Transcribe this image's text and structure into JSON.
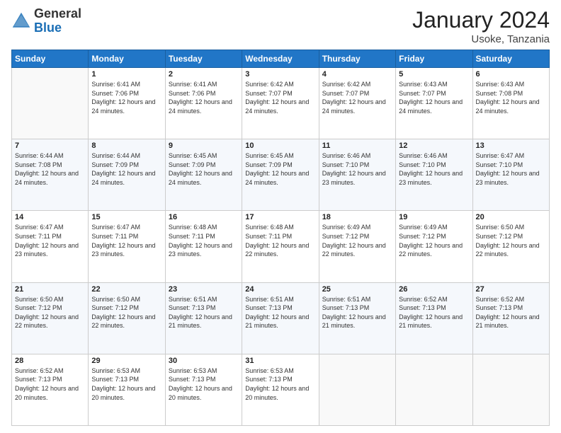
{
  "header": {
    "logo_general": "General",
    "logo_blue": "Blue",
    "month_title": "January 2024",
    "location": "Usoke, Tanzania"
  },
  "days_of_week": [
    "Sunday",
    "Monday",
    "Tuesday",
    "Wednesday",
    "Thursday",
    "Friday",
    "Saturday"
  ],
  "weeks": [
    [
      {
        "day": "",
        "sunrise": "",
        "sunset": "",
        "daylight": ""
      },
      {
        "day": "1",
        "sunrise": "6:41 AM",
        "sunset": "7:06 PM",
        "daylight": "12 hours and 24 minutes."
      },
      {
        "day": "2",
        "sunrise": "6:41 AM",
        "sunset": "7:06 PM",
        "daylight": "12 hours and 24 minutes."
      },
      {
        "day": "3",
        "sunrise": "6:42 AM",
        "sunset": "7:07 PM",
        "daylight": "12 hours and 24 minutes."
      },
      {
        "day": "4",
        "sunrise": "6:42 AM",
        "sunset": "7:07 PM",
        "daylight": "12 hours and 24 minutes."
      },
      {
        "day": "5",
        "sunrise": "6:43 AM",
        "sunset": "7:07 PM",
        "daylight": "12 hours and 24 minutes."
      },
      {
        "day": "6",
        "sunrise": "6:43 AM",
        "sunset": "7:08 PM",
        "daylight": "12 hours and 24 minutes."
      }
    ],
    [
      {
        "day": "7",
        "sunrise": "6:44 AM",
        "sunset": "7:08 PM",
        "daylight": "12 hours and 24 minutes."
      },
      {
        "day": "8",
        "sunrise": "6:44 AM",
        "sunset": "7:09 PM",
        "daylight": "12 hours and 24 minutes."
      },
      {
        "day": "9",
        "sunrise": "6:45 AM",
        "sunset": "7:09 PM",
        "daylight": "12 hours and 24 minutes."
      },
      {
        "day": "10",
        "sunrise": "6:45 AM",
        "sunset": "7:09 PM",
        "daylight": "12 hours and 24 minutes."
      },
      {
        "day": "11",
        "sunrise": "6:46 AM",
        "sunset": "7:10 PM",
        "daylight": "12 hours and 23 minutes."
      },
      {
        "day": "12",
        "sunrise": "6:46 AM",
        "sunset": "7:10 PM",
        "daylight": "12 hours and 23 minutes."
      },
      {
        "day": "13",
        "sunrise": "6:47 AM",
        "sunset": "7:10 PM",
        "daylight": "12 hours and 23 minutes."
      }
    ],
    [
      {
        "day": "14",
        "sunrise": "6:47 AM",
        "sunset": "7:11 PM",
        "daylight": "12 hours and 23 minutes."
      },
      {
        "day": "15",
        "sunrise": "6:47 AM",
        "sunset": "7:11 PM",
        "daylight": "12 hours and 23 minutes."
      },
      {
        "day": "16",
        "sunrise": "6:48 AM",
        "sunset": "7:11 PM",
        "daylight": "12 hours and 23 minutes."
      },
      {
        "day": "17",
        "sunrise": "6:48 AM",
        "sunset": "7:11 PM",
        "daylight": "12 hours and 22 minutes."
      },
      {
        "day": "18",
        "sunrise": "6:49 AM",
        "sunset": "7:12 PM",
        "daylight": "12 hours and 22 minutes."
      },
      {
        "day": "19",
        "sunrise": "6:49 AM",
        "sunset": "7:12 PM",
        "daylight": "12 hours and 22 minutes."
      },
      {
        "day": "20",
        "sunrise": "6:50 AM",
        "sunset": "7:12 PM",
        "daylight": "12 hours and 22 minutes."
      }
    ],
    [
      {
        "day": "21",
        "sunrise": "6:50 AM",
        "sunset": "7:12 PM",
        "daylight": "12 hours and 22 minutes."
      },
      {
        "day": "22",
        "sunrise": "6:50 AM",
        "sunset": "7:12 PM",
        "daylight": "12 hours and 22 minutes."
      },
      {
        "day": "23",
        "sunrise": "6:51 AM",
        "sunset": "7:13 PM",
        "daylight": "12 hours and 21 minutes."
      },
      {
        "day": "24",
        "sunrise": "6:51 AM",
        "sunset": "7:13 PM",
        "daylight": "12 hours and 21 minutes."
      },
      {
        "day": "25",
        "sunrise": "6:51 AM",
        "sunset": "7:13 PM",
        "daylight": "12 hours and 21 minutes."
      },
      {
        "day": "26",
        "sunrise": "6:52 AM",
        "sunset": "7:13 PM",
        "daylight": "12 hours and 21 minutes."
      },
      {
        "day": "27",
        "sunrise": "6:52 AM",
        "sunset": "7:13 PM",
        "daylight": "12 hours and 21 minutes."
      }
    ],
    [
      {
        "day": "28",
        "sunrise": "6:52 AM",
        "sunset": "7:13 PM",
        "daylight": "12 hours and 20 minutes."
      },
      {
        "day": "29",
        "sunrise": "6:53 AM",
        "sunset": "7:13 PM",
        "daylight": "12 hours and 20 minutes."
      },
      {
        "day": "30",
        "sunrise": "6:53 AM",
        "sunset": "7:13 PM",
        "daylight": "12 hours and 20 minutes."
      },
      {
        "day": "31",
        "sunrise": "6:53 AM",
        "sunset": "7:13 PM",
        "daylight": "12 hours and 20 minutes."
      },
      {
        "day": "",
        "sunrise": "",
        "sunset": "",
        "daylight": ""
      },
      {
        "day": "",
        "sunrise": "",
        "sunset": "",
        "daylight": ""
      },
      {
        "day": "",
        "sunrise": "",
        "sunset": "",
        "daylight": ""
      }
    ]
  ],
  "labels": {
    "sunrise": "Sunrise:",
    "sunset": "Sunset:",
    "daylight": "Daylight:"
  }
}
